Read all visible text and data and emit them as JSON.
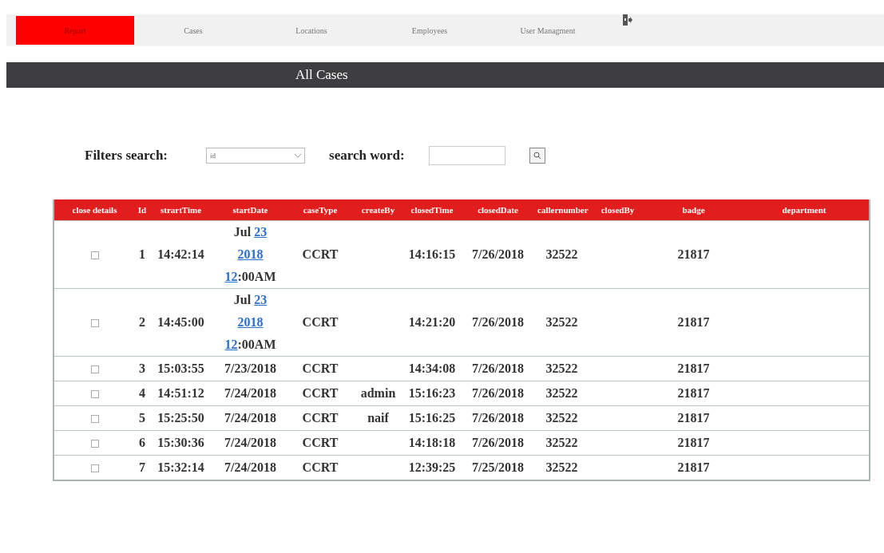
{
  "nav": {
    "tabs": [
      {
        "label": "Report",
        "selected": true
      },
      {
        "label": "Cases",
        "selected": false
      },
      {
        "label": "Locations",
        "selected": false
      },
      {
        "label": "Employees",
        "selected": false
      },
      {
        "label": "User Managment",
        "selected": false
      }
    ]
  },
  "page_title": "All Cases",
  "filters": {
    "label": "Filters search:",
    "select_value": "id",
    "search_label": "search word:"
  },
  "table": {
    "columns": [
      "close details",
      "Id",
      "strartTime",
      "startDate",
      "caseType",
      "createBy",
      "closedTime",
      "closedDate",
      "callernumber",
      "closedBy",
      "badge",
      "department"
    ],
    "rows": [
      {
        "checked": false,
        "id": "1",
        "startTime": "14:42:14",
        "startDate": [
          [
            {
              "text": "Jul ",
              "link": false
            },
            {
              "text": "23",
              "link": true
            }
          ],
          [
            {
              "text": "2018",
              "link": true
            }
          ],
          [
            {
              "text": "12",
              "link": true
            },
            {
              "text": ":00AM",
              "link": false
            }
          ]
        ],
        "caseType": "CCRT",
        "closedTime": "14:16:15",
        "closedDate": "7/26/2018",
        "callernumber": "32522",
        "badge": "21817"
      },
      {
        "checked": false,
        "id": "2",
        "startTime": "14:45:00",
        "startDate": [
          [
            {
              "text": "Jul ",
              "link": false
            },
            {
              "text": "23",
              "link": true
            }
          ],
          [
            {
              "text": "2018",
              "link": true
            }
          ],
          [
            {
              "text": "12",
              "link": true
            },
            {
              "text": ":00AM",
              "link": false
            }
          ]
        ],
        "caseType": "CCRT",
        "closedTime": "14:21:20",
        "closedDate": "7/26/2018",
        "callernumber": "32522",
        "badge": "21817"
      },
      {
        "checked": false,
        "id": "3",
        "startTime": "15:03:55",
        "startDate": [
          [
            {
              "text": "7/23/2018",
              "link": false
            }
          ]
        ],
        "caseType": "CCRT",
        "closedTime": "14:34:08",
        "closedDate": "7/26/2018",
        "callernumber": "32522",
        "badge": "21817"
      },
      {
        "checked": false,
        "id": "4",
        "startTime": "14:51:12",
        "startDate": [
          [
            {
              "text": "7/24/2018",
              "link": false
            }
          ]
        ],
        "caseType": "CCRT",
        "createBy": "admin",
        "closedTime": "15:16:23",
        "closedDate": "7/26/2018",
        "callernumber": "32522",
        "badge": "21817"
      },
      {
        "checked": false,
        "id": "5",
        "startTime": "15:25:50",
        "startDate": [
          [
            {
              "text": "7/24/2018",
              "link": false
            }
          ]
        ],
        "caseType": "CCRT",
        "createBy": "naif",
        "closedTime": "15:16:25",
        "closedDate": "7/26/2018",
        "callernumber": "32522",
        "badge": "21817"
      },
      {
        "checked": false,
        "id": "6",
        "startTime": "15:30:36",
        "startDate": [
          [
            {
              "text": "7/24/2018",
              "link": false
            }
          ]
        ],
        "caseType": "CCRT",
        "closedTime": "14:18:18",
        "closedDate": "7/26/2018",
        "callernumber": "32522",
        "badge": "21817"
      },
      {
        "checked": false,
        "id": "7",
        "startTime": "15:32:14",
        "startDate": [
          [
            {
              "text": "7/24/2018",
              "link": false
            }
          ]
        ],
        "caseType": "CCRT",
        "closedTime": "12:39:25",
        "closedDate": "7/25/2018",
        "callernumber": "32522",
        "badge": "21817"
      }
    ]
  }
}
